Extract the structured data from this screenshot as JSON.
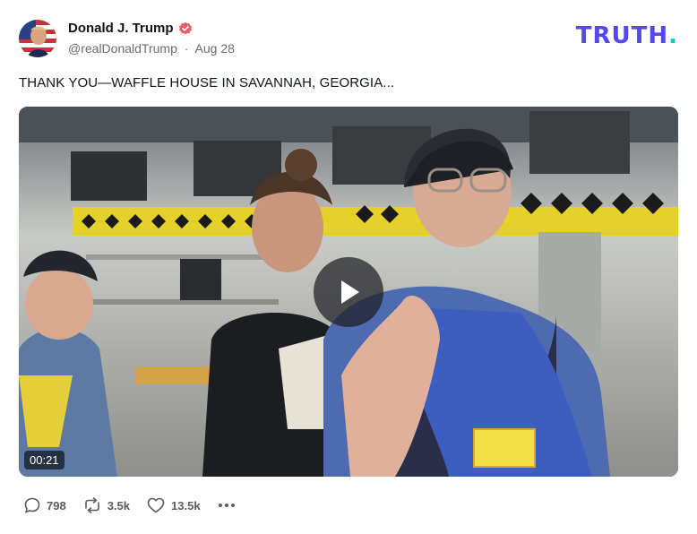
{
  "author": {
    "display_name": "Donald J. Trump",
    "handle": "@realDonaldTrump",
    "separator": "·",
    "date": "Aug 28",
    "verified_icon": "verified-badge-icon"
  },
  "brand": {
    "logo_text": "TRUTH",
    "logo_dot": ".",
    "color": "#5448ee",
    "dot_color": "#0fcdbd"
  },
  "post": {
    "text": "THANK YOU—WAFFLE HOUSE IN SAVANNAH, GEORGIA..."
  },
  "video": {
    "duration": "00:21",
    "play_icon": "play-icon"
  },
  "actions": {
    "replies": "798",
    "retruths": "3.5k",
    "likes": "13.5k",
    "reply_icon": "reply-icon",
    "retruth_icon": "retruth-icon",
    "like_icon": "heart-icon",
    "more_icon": "more-dots-icon"
  }
}
